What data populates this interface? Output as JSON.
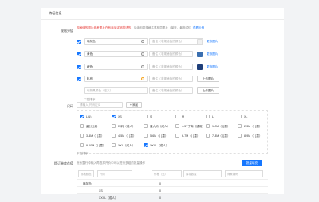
{
  "section_title": "特征信息",
  "spec": {
    "label": "规格分值",
    "tip_red": "规格值的图片参考图片在有商品详细描述的",
    "tip_gray": "，后续相同规格共享相同图片（单张，最多5张）",
    "tip_link": "查看示例",
    "rows": [
      {
        "name": "暗灰色",
        "placeholder": "备注（非规格值的颜色）",
        "char_count": "7/5",
        "color": "#eeeeee",
        "link": "更换图片"
      },
      {
        "name": "黄色",
        "placeholder": "备注（非规格值的颜色）",
        "color": "#3b6fb0",
        "link": "更换图片"
      },
      {
        "name": "藏色",
        "placeholder": "备注（非规格值的颜色）",
        "color": "#1f3f7a",
        "link": "更换图片"
      },
      {
        "name": "料布",
        "placeholder": "备注（非规格值的颜色）",
        "button": "上传图片"
      }
    ],
    "new_placeholder": "填新具颜色（定义）",
    "new_note_placeholder": "备注（非规格值的颜色）",
    "new_button": "上传图片",
    "footer": "下拉排序"
  },
  "size": {
    "label": "尺码",
    "select_placeholder": "请输入 尺码定义",
    "add_button": "+ 添加",
    "options": [
      {
        "label": "L(1)",
        "checked": true
      },
      {
        "label": "XS",
        "checked": true
      },
      {
        "label": "S",
        "checked": false
      },
      {
        "label": "M",
        "checked": false
      },
      {
        "label": "L",
        "checked": false
      },
      {
        "label": "XL",
        "checked": false
      },
      {
        "label": "菌分元码",
        "checked": false
      },
      {
        "label": "均码（成人）",
        "checked": false
      },
      {
        "label": "重大码（成人）",
        "checked": false
      },
      {
        "label": "4-5T子商（通用）",
        "checked": false
      },
      {
        "label": "1-2M（儿童）",
        "checked": false
      },
      {
        "label": "2-3M（儿童）",
        "checked": false
      },
      {
        "label": "3-4M（儿童）",
        "checked": false
      },
      {
        "label": "4-5M（儿童）",
        "checked": false
      },
      {
        "label": "5-6M（儿童）",
        "checked": false
      },
      {
        "label": "6-7M（儿童）",
        "checked": false
      },
      {
        "label": "7-8M（儿童）",
        "checked": false
      },
      {
        "label": "8-9M（儿童）",
        "checked": false
      },
      {
        "label": "9-10M（儿童）",
        "checked": false
      },
      {
        "label": "XXL（成人）",
        "checked": false
      },
      {
        "label": "XXXL（成人）",
        "checked": true
      }
    ],
    "footer": "下拉排序"
  },
  "stock": {
    "label": "提订单库存值",
    "tip": "批价整行中输入再选择开价中可以进行多组的批量操作",
    "bulk_button": "批量填充",
    "headers": [
      "规格颜色",
      "尺码",
      "价格（元）",
      "库存数量",
      "商家编码"
    ],
    "rows": [
      {
        "color": "暗灰色",
        "size": "",
        "price": "0"
      },
      {
        "color": "",
        "size": "XS",
        "price": "0"
      },
      {
        "color": "",
        "size": "XXXL（成人）",
        "price": "0"
      }
    ]
  }
}
